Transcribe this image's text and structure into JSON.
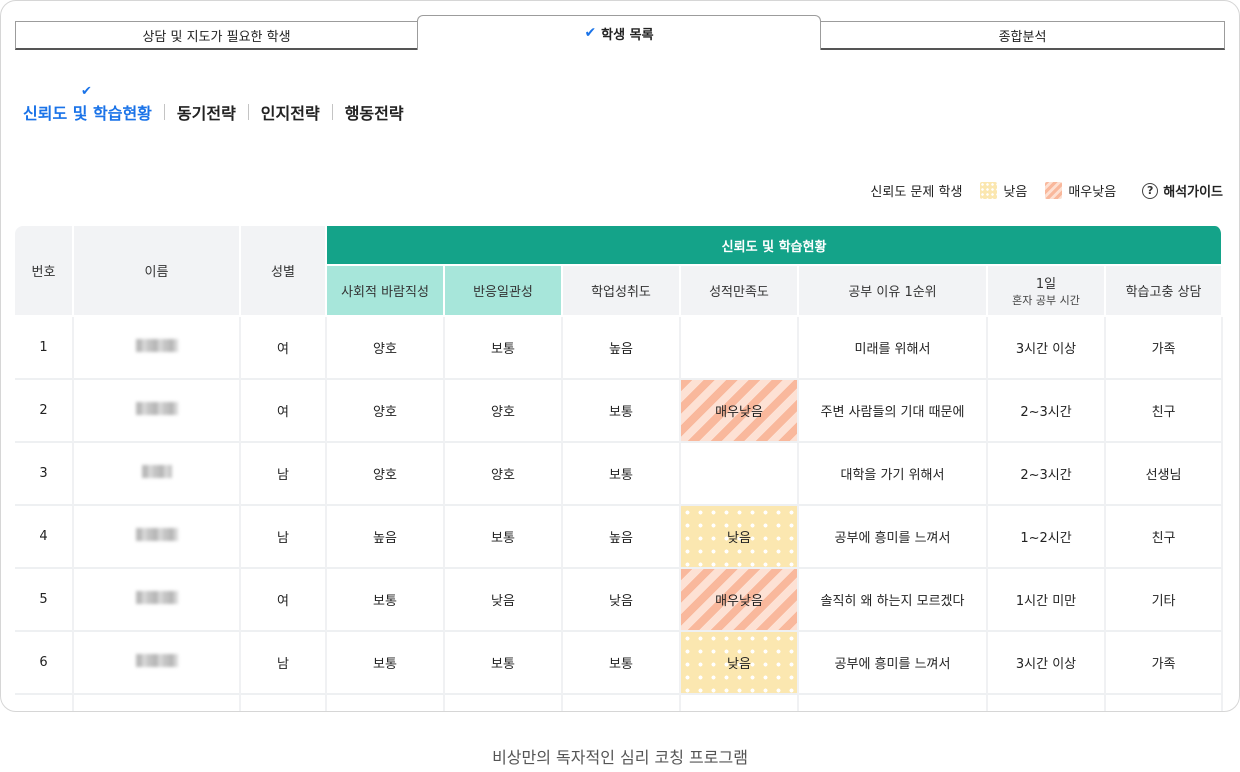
{
  "tabs": [
    {
      "label": "상담 및 지도가 필요한 학생"
    },
    {
      "label": "학생 목록",
      "active": true
    },
    {
      "label": "종합분석"
    }
  ],
  "subnav": [
    {
      "label": "신뢰도 및 학습현황",
      "active": true
    },
    {
      "label": "동기전략"
    },
    {
      "label": "인지전략"
    },
    {
      "label": "행동전략"
    }
  ],
  "legend": {
    "reliability": "신뢰도 문제 학생",
    "low": "낮음",
    "very_low": "매우낮음",
    "guide": "해석가이드",
    "guide_icon": "?"
  },
  "colors": {
    "accent": "#1a73e8",
    "header_green": "#14a389",
    "mint": "#a7e6da",
    "low": "#fbe7b0",
    "very_low": "#f9b89c"
  },
  "table": {
    "col_no": "번호",
    "col_name": "이름",
    "col_gender": "성별",
    "group": "신뢰도 및 학습현황",
    "col_social": "사회적 바람직성",
    "col_consistency": "반응일관성",
    "col_achievement": "학업성취도",
    "col_satisfaction": "성적만족도",
    "col_reason": "공부 이유 1순위",
    "col_hours_1": "1일",
    "col_hours_2": "혼자 공부 시간",
    "col_counsel": "학습고충 상담",
    "rows": [
      {
        "no": "1",
        "gender": "여",
        "social": "양호",
        "consistency": "보통",
        "achievement": "높음",
        "satisfaction": "",
        "reason": "미래를 위해서",
        "hours": "3시간 이상",
        "counsel": "가족"
      },
      {
        "no": "2",
        "gender": "여",
        "social": "양호",
        "consistency": "양호",
        "achievement": "보통",
        "satisfaction": "매우낮음",
        "reason": "주변 사람들의 기대 때문에",
        "hours": "2~3시간",
        "counsel": "친구"
      },
      {
        "no": "3",
        "gender": "남",
        "social": "양호",
        "consistency": "양호",
        "achievement": "보통",
        "satisfaction": "",
        "reason": "대학을 가기 위해서",
        "hours": "2~3시간",
        "counsel": "선생님"
      },
      {
        "no": "4",
        "gender": "남",
        "social": "높음",
        "consistency": "보통",
        "achievement": "높음",
        "satisfaction": "낮음",
        "reason": "공부에 흥미를 느껴서",
        "hours": "1~2시간",
        "counsel": "친구"
      },
      {
        "no": "5",
        "gender": "여",
        "social": "보통",
        "consistency": "낮음",
        "achievement": "낮음",
        "satisfaction": "매우낮음",
        "reason": "솔직히 왜 하는지 모르겠다",
        "hours": "1시간 미만",
        "counsel": "기타"
      },
      {
        "no": "6",
        "gender": "남",
        "social": "보통",
        "consistency": "보통",
        "achievement": "보통",
        "satisfaction": "낮음",
        "reason": "공부에 흥미를 느껴서",
        "hours": "3시간 이상",
        "counsel": "가족"
      }
    ]
  },
  "caption": "비상만의 독자적인 심리 코칭 프로그램"
}
